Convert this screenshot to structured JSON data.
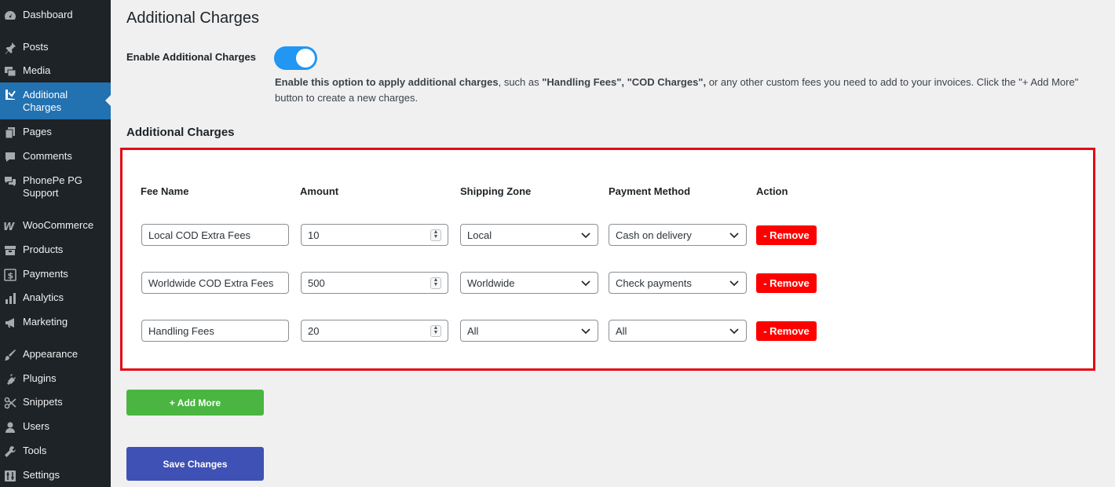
{
  "sidebar": {
    "items": [
      {
        "label": "Dashboard",
        "icon": "dashboard-icon"
      },
      {
        "label": "Posts",
        "icon": "pin-icon"
      },
      {
        "label": "Media",
        "icon": "media-icon"
      },
      {
        "label": "Additional Charges",
        "icon": "bars-icon",
        "active": true
      },
      {
        "label": "Pages",
        "icon": "page-icon"
      },
      {
        "label": "Comments",
        "icon": "comment-icon"
      },
      {
        "label": "PhonePe PG Support",
        "icon": "comments-icon"
      },
      {
        "label": "WooCommerce",
        "icon": "woocommerce-icon"
      },
      {
        "label": "Products",
        "icon": "archive-icon"
      },
      {
        "label": "Payments",
        "icon": "dollar-icon"
      },
      {
        "label": "Analytics",
        "icon": "chart-icon"
      },
      {
        "label": "Marketing",
        "icon": "megaphone-icon"
      },
      {
        "label": "Appearance",
        "icon": "brush-icon"
      },
      {
        "label": "Plugins",
        "icon": "plug-icon"
      },
      {
        "label": "Snippets",
        "icon": "scissors-icon"
      },
      {
        "label": "Users",
        "icon": "user-icon"
      },
      {
        "label": "Tools",
        "icon": "wrench-icon"
      },
      {
        "label": "Settings",
        "icon": "settings-icon"
      }
    ]
  },
  "main": {
    "title": "Additional Charges",
    "enable": {
      "label": "Enable Additional Charges",
      "enabled": true,
      "description_bold1": "Enable this option to apply additional charges",
      "description_text1": ", such as ",
      "description_bold2": "\"Handling Fees\", \"COD Charges\",",
      "description_text2": " or any other custom fees you need to add to your invoices. Click the \"+ Add More\" button to create a new charges."
    },
    "section_title": "Additional Charges",
    "columns": {
      "fee_name": "Fee Name",
      "amount": "Amount",
      "shipping_zone": "Shipping Zone",
      "payment_method": "Payment Method",
      "action": "Action"
    },
    "rows": [
      {
        "fee_name": "Local COD Extra Fees",
        "amount": "10",
        "shipping_zone": "Local",
        "payment_method": "Cash on delivery",
        "remove_label": "- Remove"
      },
      {
        "fee_name": "Worldwide COD Extra Fees",
        "amount": "500",
        "shipping_zone": "Worldwide",
        "payment_method": "Check payments",
        "remove_label": "- Remove"
      },
      {
        "fee_name": "Handling Fees",
        "amount": "20",
        "shipping_zone": "All",
        "payment_method": "All",
        "remove_label": "- Remove"
      }
    ],
    "add_more_label": "+ Add More",
    "save_label": "Save Changes"
  },
  "colors": {
    "sidebar_bg": "#1d2327",
    "active": "#2271b1",
    "toggle": "#2196f3",
    "highlight_border": "#e50914",
    "remove": "#ff0000",
    "add_more": "#4ab641",
    "save": "#3f51b5"
  }
}
